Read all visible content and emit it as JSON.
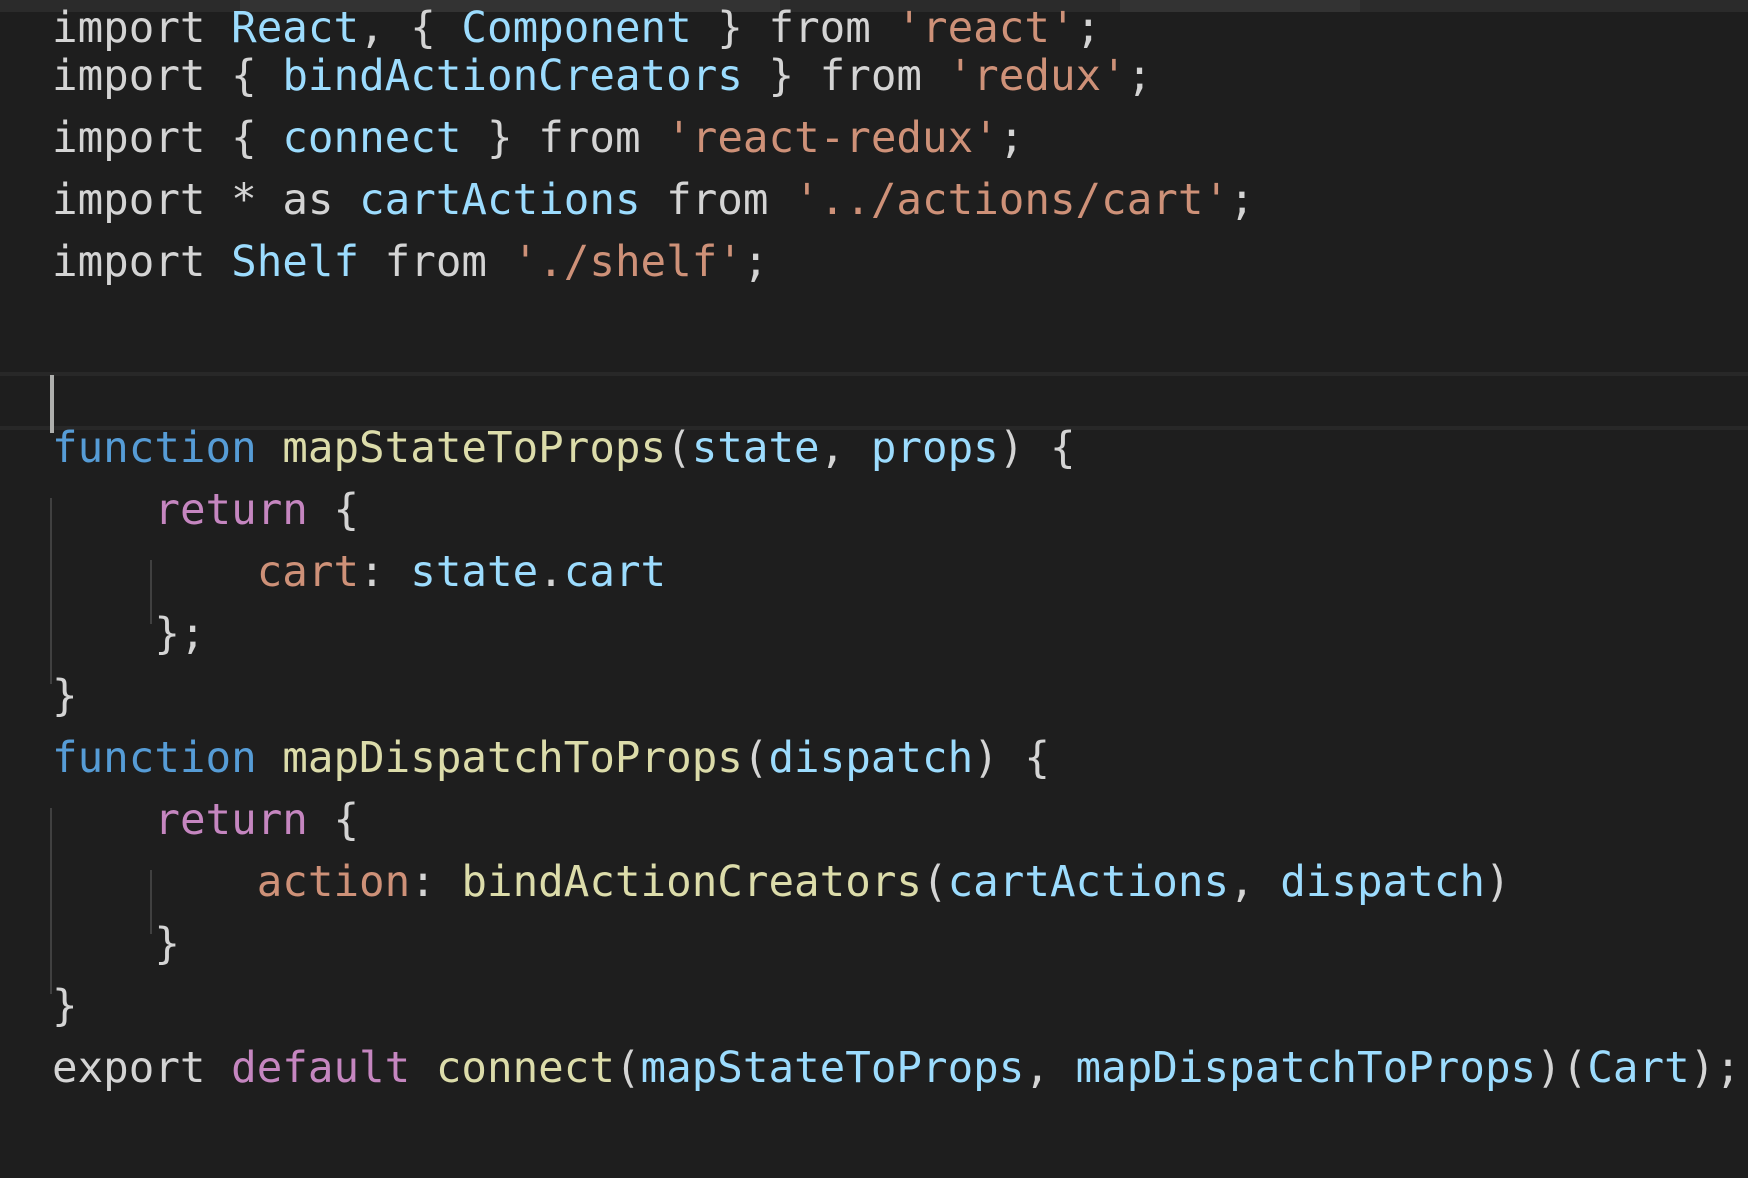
{
  "editor": {
    "lines": [
      [
        {
          "t": "import ",
          "c": "kw"
        },
        {
          "t": "React",
          "c": "var"
        },
        {
          "t": ", { ",
          "c": "punc"
        },
        {
          "t": "Component",
          "c": "var"
        },
        {
          "t": " } ",
          "c": "punc"
        },
        {
          "t": "from ",
          "c": "kw"
        },
        {
          "t": "'react'",
          "c": "str"
        },
        {
          "t": ";",
          "c": "punc"
        }
      ],
      [
        {
          "t": "import ",
          "c": "kw"
        },
        {
          "t": "{ ",
          "c": "punc"
        },
        {
          "t": "bindActionCreators",
          "c": "var"
        },
        {
          "t": " } ",
          "c": "punc"
        },
        {
          "t": "from ",
          "c": "kw"
        },
        {
          "t": "'redux'",
          "c": "str"
        },
        {
          "t": ";",
          "c": "punc"
        }
      ],
      [
        {
          "t": "import ",
          "c": "kw"
        },
        {
          "t": "{ ",
          "c": "punc"
        },
        {
          "t": "connect",
          "c": "var"
        },
        {
          "t": " } ",
          "c": "punc"
        },
        {
          "t": "from ",
          "c": "kw"
        },
        {
          "t": "'react-redux'",
          "c": "str"
        },
        {
          "t": ";",
          "c": "punc"
        }
      ],
      [
        {
          "t": "import ",
          "c": "kw"
        },
        {
          "t": "* ",
          "c": "punc"
        },
        {
          "t": "as ",
          "c": "kw"
        },
        {
          "t": "cartActions",
          "c": "var"
        },
        {
          "t": " from ",
          "c": "kw"
        },
        {
          "t": "'../actions/cart'",
          "c": "str"
        },
        {
          "t": ";",
          "c": "punc"
        }
      ],
      [
        {
          "t": "import ",
          "c": "kw"
        },
        {
          "t": "Shelf",
          "c": "var"
        },
        {
          "t": " from ",
          "c": "kw"
        },
        {
          "t": "'./shelf'",
          "c": "str"
        },
        {
          "t": ";",
          "c": "punc"
        }
      ],
      [],
      [],
      [
        {
          "t": "function ",
          "c": "fn-kw"
        },
        {
          "t": "mapStateToProps",
          "c": "fn"
        },
        {
          "t": "(",
          "c": "punc"
        },
        {
          "t": "state",
          "c": "var"
        },
        {
          "t": ", ",
          "c": "punc"
        },
        {
          "t": "props",
          "c": "var"
        },
        {
          "t": ") {",
          "c": "punc"
        }
      ],
      [
        {
          "t": "    ",
          "c": "punc"
        },
        {
          "t": "return",
          "c": "ctl"
        },
        {
          "t": " {",
          "c": "punc"
        }
      ],
      [
        {
          "t": "        ",
          "c": "punc"
        },
        {
          "t": "cart",
          "c": "prop"
        },
        {
          "t": ": ",
          "c": "punc"
        },
        {
          "t": "state",
          "c": "var"
        },
        {
          "t": ".",
          "c": "punc"
        },
        {
          "t": "cart",
          "c": "var"
        }
      ],
      [
        {
          "t": "    };",
          "c": "punc"
        }
      ],
      [
        {
          "t": "}",
          "c": "punc"
        }
      ],
      [
        {
          "t": "function ",
          "c": "fn-kw"
        },
        {
          "t": "mapDispatchToProps",
          "c": "fn"
        },
        {
          "t": "(",
          "c": "punc"
        },
        {
          "t": "dispatch",
          "c": "var"
        },
        {
          "t": ") {",
          "c": "punc"
        }
      ],
      [
        {
          "t": "    ",
          "c": "punc"
        },
        {
          "t": "return",
          "c": "ctl"
        },
        {
          "t": " {",
          "c": "punc"
        }
      ],
      [
        {
          "t": "        ",
          "c": "punc"
        },
        {
          "t": "action",
          "c": "prop"
        },
        {
          "t": ": ",
          "c": "punc"
        },
        {
          "t": "bindActionCreators",
          "c": "fn"
        },
        {
          "t": "(",
          "c": "punc"
        },
        {
          "t": "cartActions",
          "c": "var"
        },
        {
          "t": ", ",
          "c": "punc"
        },
        {
          "t": "dispatch",
          "c": "var"
        },
        {
          "t": ")",
          "c": "punc"
        }
      ],
      [
        {
          "t": "    }",
          "c": "punc"
        }
      ],
      [
        {
          "t": "}",
          "c": "punc"
        }
      ],
      [
        {
          "t": "export ",
          "c": "kw"
        },
        {
          "t": "default ",
          "c": "ctl"
        },
        {
          "t": "connect",
          "c": "fn"
        },
        {
          "t": "(",
          "c": "punc"
        },
        {
          "t": "mapStateToProps",
          "c": "var"
        },
        {
          "t": ", ",
          "c": "punc"
        },
        {
          "t": "mapDispatchToProps",
          "c": "var"
        },
        {
          "t": ")(",
          "c": "punc"
        },
        {
          "t": "Cart",
          "c": "var"
        },
        {
          "t": ");",
          "c": "punc"
        }
      ]
    ]
  },
  "colors": {
    "background": "#1e1e1e",
    "keyword": "#d4d4d4",
    "control": "#c586c0",
    "function_keyword": "#569cd6",
    "variable": "#9cdcfe",
    "function": "#dcdcaa",
    "string": "#ce9178"
  }
}
